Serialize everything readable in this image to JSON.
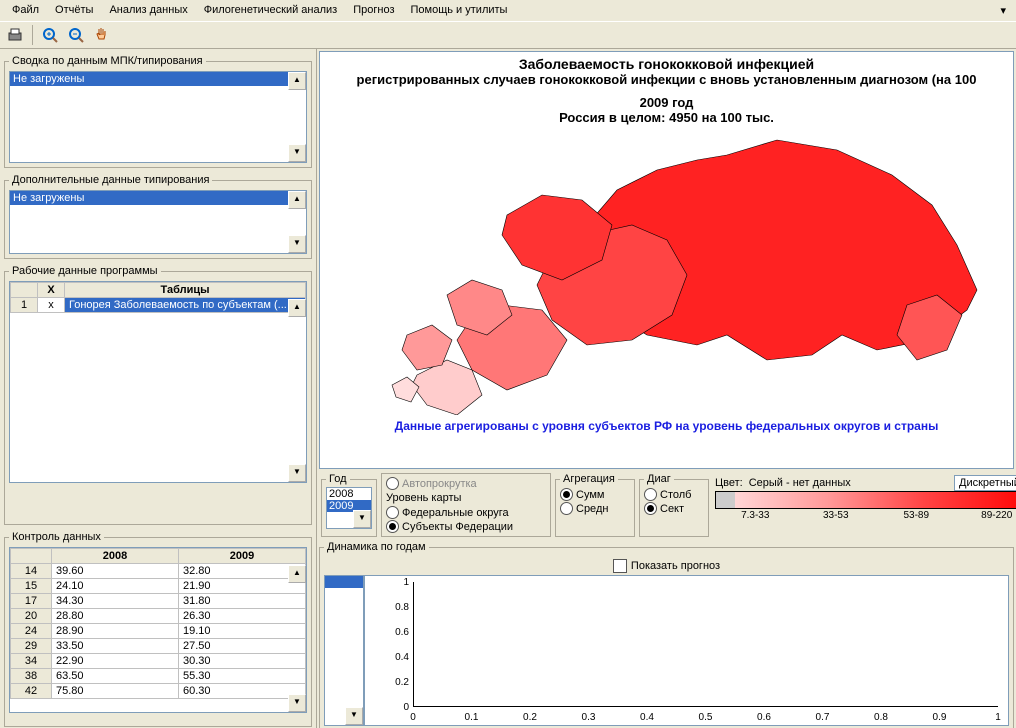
{
  "menus": {
    "file": "Файл",
    "reports": "Отчёты",
    "analysis": "Анализ данных",
    "phylo": "Филогенетический анализ",
    "forecast": "Прогноз",
    "help": "Помощь и утилиты"
  },
  "panels": {
    "summary": {
      "title": "Сводка по данным МПК/типирования",
      "item": "Не загружены"
    },
    "extra": {
      "title": "Дополнительные данные типирования",
      "item": "Не загружены"
    },
    "work": {
      "title": "Рабочие данные программы",
      "col_x": "X",
      "col_tables": "Таблицы",
      "row_num": "1",
      "row_x": "x",
      "row_label": "Гонорея Заболеваемость по субъектам (..."
    },
    "control": {
      "title": "Контроль данных"
    }
  },
  "data_table": {
    "headers": [
      "2008",
      "2009"
    ],
    "rows": [
      {
        "id": "14",
        "a": "39.60",
        "b": "32.80"
      },
      {
        "id": "15",
        "a": "24.10",
        "b": "21.90"
      },
      {
        "id": "17",
        "a": "34.30",
        "b": "31.80"
      },
      {
        "id": "20",
        "a": "28.80",
        "b": "26.30"
      },
      {
        "id": "24",
        "a": "28.90",
        "b": "19.10"
      },
      {
        "id": "29",
        "a": "33.50",
        "b": "27.50"
      },
      {
        "id": "34",
        "a": "22.90",
        "b": "30.30"
      },
      {
        "id": "38",
        "a": "63.50",
        "b": "55.30"
      },
      {
        "id": "42",
        "a": "75.80",
        "b": "60.30"
      }
    ]
  },
  "map": {
    "title1": "Заболеваемость гонококковой инфекцией",
    "title2": "регистрированных случаев гонококковой инфекции с вновь установленным диагнозом (на 100",
    "year": "2009 год",
    "total": "Россия в целом: 4950 на 100 тыс.",
    "note": "Данные агрегированы с уровня субъектов РФ на уровень федеральных округов и страны"
  },
  "controls": {
    "year_label": "Год",
    "autoscroll": "Автопрокрутка",
    "years": [
      "2008",
      "2009"
    ],
    "level_label": "Уровень карты",
    "level_opts": [
      "Федеральные округа",
      "Субъекты Федерации"
    ],
    "agg_label": "Агрегация",
    "agg_opts": [
      "Сумм",
      "Средн"
    ],
    "diag_label": "Диаг",
    "diag_opts": [
      "Столб",
      "Сект"
    ],
    "color_label": "Цвет:",
    "color_note": "Серый - нет данных",
    "color_mode": "Дискретный",
    "scale": [
      "7.3-33",
      "33-53",
      "53-89",
      "89-220"
    ]
  },
  "dynamic": {
    "title": "Динамика по годам",
    "show_forecast": "Показать прогноз",
    "yticks": [
      "0",
      "0.2",
      "0.4",
      "0.6",
      "0.8",
      "1"
    ],
    "xticks": [
      "0",
      "0.1",
      "0.2",
      "0.3",
      "0.4",
      "0.5",
      "0.6",
      "0.7",
      "0.8",
      "0.9",
      "1"
    ]
  },
  "chart_data": {
    "type": "line",
    "title": "Динамика по годам",
    "xlabel": "",
    "ylabel": "",
    "x": [
      0,
      0.1,
      0.2,
      0.3,
      0.4,
      0.5,
      0.6,
      0.7,
      0.8,
      0.9,
      1
    ],
    "series": [],
    "ylim": [
      0,
      1
    ],
    "xlim": [
      0,
      1
    ]
  }
}
